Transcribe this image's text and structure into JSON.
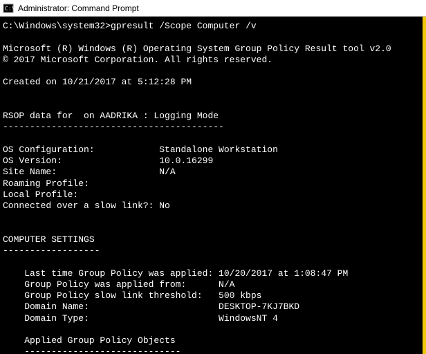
{
  "window": {
    "title": "Administrator: Command Prompt"
  },
  "prompt": {
    "path": "C:\\Windows\\system32>",
    "command": "gpresult /Scope Computer /v"
  },
  "header": {
    "line1": "Microsoft (R) Windows (R) Operating System Group Policy Result tool v2.0",
    "line2": "© 2017 Microsoft Corporation. All rights reserved."
  },
  "created": "Created on ‎10/‎21/‎2017 at 5:12:28 PM",
  "rsop": {
    "line": "RSOP data for  on AADRIKA : Logging Mode",
    "dashes": "-----------------------------------------"
  },
  "config": {
    "os_config_label": "OS Configuration:            Standalone Workstation",
    "os_version_label": "OS Version:                  10.0.16299",
    "site_name_label": "Site Name:                   N/A",
    "roaming": "Roaming Profile:",
    "local": "Local Profile:",
    "slowlink": "Connected over a slow link?: No"
  },
  "computer_settings": {
    "header": "COMPUTER SETTINGS",
    "dashes": "------------------"
  },
  "gp": {
    "last_applied": "    Last time Group Policy was applied: 10/20/2017 at 1:08:47 PM",
    "applied_from": "    Group Policy was applied from:      N/A",
    "threshold": "    Group Policy slow link threshold:   500 kbps",
    "domain_name": "    Domain Name:                        DESKTOP-7KJ7BKD",
    "domain_type": "    Domain Type:                        WindowsNT 4"
  },
  "applied_gpo": {
    "header": "    Applied Group Policy Objects",
    "dashes": "    -----------------------------"
  }
}
